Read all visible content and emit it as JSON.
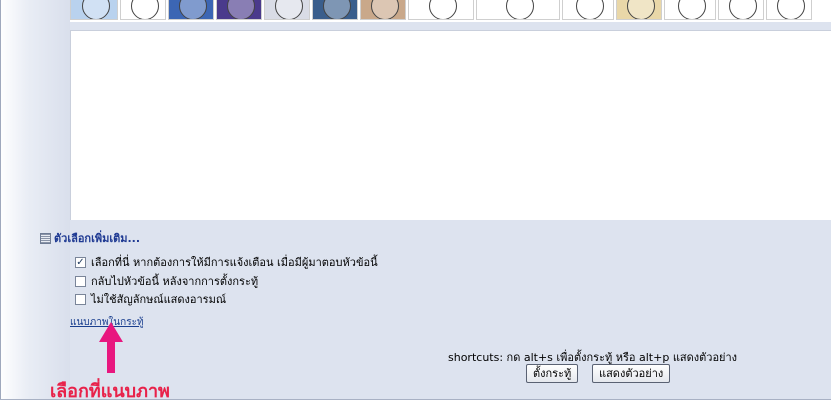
{
  "smilies": {
    "items": [
      {
        "name": "smiley-1",
        "color": "#b9d2ee",
        "w": 48
      },
      {
        "name": "smiley-2",
        "color": "#ffffff",
        "w": 46
      },
      {
        "name": "smiley-3",
        "color": "#3c66b4",
        "w": 46
      },
      {
        "name": "smiley-4",
        "color": "#4a3a8c",
        "w": 46
      },
      {
        "name": "smiley-5",
        "color": "#d9dce6",
        "w": 46
      },
      {
        "name": "smiley-6",
        "color": "#3a5e8c",
        "w": 46
      },
      {
        "name": "smiley-7",
        "color": "#c9a88a",
        "w": 46
      },
      {
        "name": "smiley-8",
        "color": "#ffffff",
        "w": 66
      },
      {
        "name": "smiley-9",
        "color": "#ffffff",
        "w": 84
      },
      {
        "name": "smiley-10",
        "color": "#ffffff",
        "w": 52
      },
      {
        "name": "smiley-11",
        "color": "#e9d7a8",
        "w": 46
      },
      {
        "name": "smiley-12",
        "color": "#ffffff",
        "w": 52
      },
      {
        "name": "smiley-13",
        "color": "#ffffff",
        "w": 46
      },
      {
        "name": "smiley-14",
        "color": "#ffffff",
        "w": 46
      }
    ]
  },
  "options": {
    "heading": "ตัวเลือกเพิ่มเติม...",
    "items": [
      {
        "label": "เลือกที่นี่ หากต้องการให้มีการแจ้งเตือน เมื่อมีผู้มาตอบหัวข้อนี้",
        "checked": true
      },
      {
        "label": "กลับไปหัวข้อนี้ หลังจากการตั้งกระทู้",
        "checked": false
      },
      {
        "label": "ไม่ใช้สัญลักษณ์แสดงอารมณ์",
        "checked": false
      }
    ],
    "attach_link": "แนบภาพในกระทู้"
  },
  "annotation": {
    "text": "เลือกที่แนบภาพ",
    "color": "#e8224a"
  },
  "footer": {
    "shortcuts": "shortcuts: กด alt+s เพื่อตั้งกระทู้ หรือ alt+p แสดงตัวอย่าง",
    "post_button": "ตั้งกระทู้",
    "preview_button": "แสดงตัวอย่าง"
  }
}
